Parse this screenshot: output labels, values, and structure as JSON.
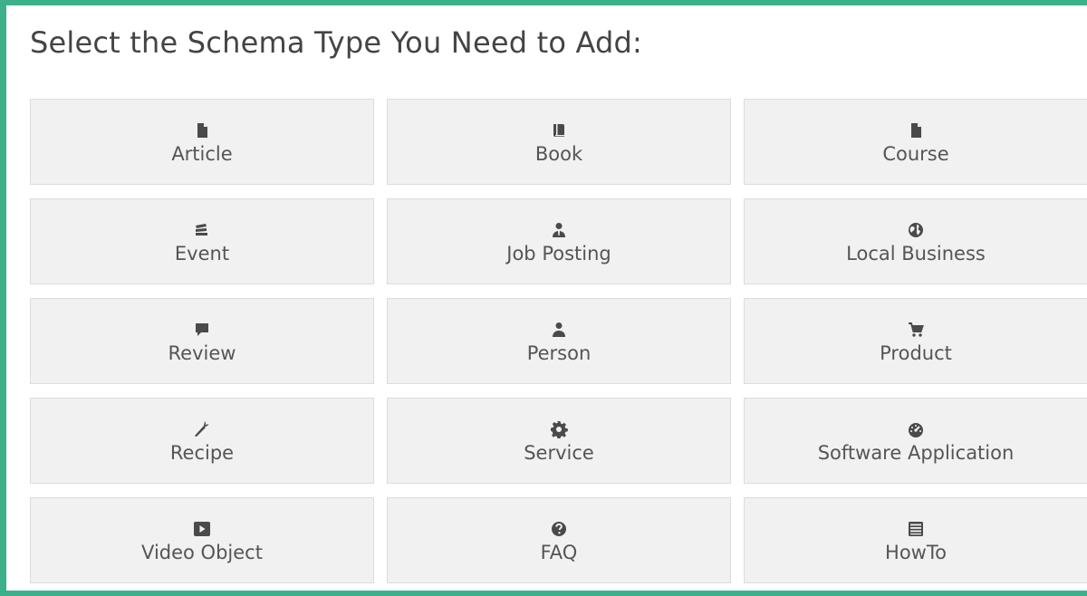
{
  "heading": "Select the Schema Type You Need to Add:",
  "accent_color": "#3bb08a",
  "schema_types": [
    {
      "label": "Article",
      "icon": "file-icon"
    },
    {
      "label": "Book",
      "icon": "book-icon"
    },
    {
      "label": "Course",
      "icon": "file-icon"
    },
    {
      "label": "Event",
      "icon": "ticket-icon"
    },
    {
      "label": "Job Posting",
      "icon": "user-tie-icon"
    },
    {
      "label": "Local Business",
      "icon": "globe-icon"
    },
    {
      "label": "Review",
      "icon": "comment-icon"
    },
    {
      "label": "Person",
      "icon": "user-icon"
    },
    {
      "label": "Product",
      "icon": "cart-icon"
    },
    {
      "label": "Recipe",
      "icon": "carrot-icon"
    },
    {
      "label": "Service",
      "icon": "gear-icon"
    },
    {
      "label": "Software Application",
      "icon": "dashboard-icon"
    },
    {
      "label": "Video Object",
      "icon": "video-play-icon"
    },
    {
      "label": "FAQ",
      "icon": "question-circle-icon"
    },
    {
      "label": "HowTo",
      "icon": "list-icon"
    }
  ]
}
